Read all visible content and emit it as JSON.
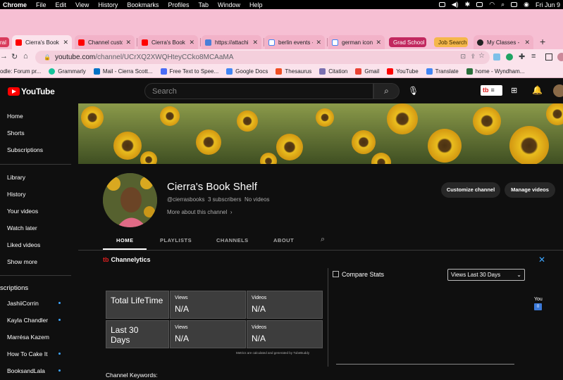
{
  "menubar": {
    "app": "Chrome",
    "items": [
      "File",
      "Edit",
      "View",
      "History",
      "Bookmarks",
      "Profiles",
      "Tab",
      "Window",
      "Help"
    ],
    "clock": "Fri Jun 9"
  },
  "tabs": [
    {
      "label": "ral",
      "type": "group_chip",
      "color": "#d93a5c"
    },
    {
      "label": "Cierra's Book S",
      "icon": "youtube-icon",
      "active": true
    },
    {
      "label": "Channel custo",
      "icon": "youtube-icon"
    },
    {
      "label": "Cierra's Book S",
      "icon": "youtube-icon"
    },
    {
      "label": "https://attachi",
      "icon": "attachment-icon"
    },
    {
      "label": "berlin events -",
      "icon": "google-icon"
    },
    {
      "label": "german iconog",
      "icon": "google-icon"
    },
    {
      "label": "Grad School",
      "type": "group_chip",
      "color": "#c2285f"
    },
    {
      "label": "Job Search",
      "type": "group_chip",
      "color": "#f5b74a"
    },
    {
      "label": "My Classes - S",
      "icon": "classes-icon"
    }
  ],
  "address": {
    "domain": "youtube.com",
    "path": "/channel/UCrXQ2XWQHteyCCko8MCAaMA"
  },
  "bookmarks": [
    {
      "label": "odle: Forum pr...",
      "color": "#f29900"
    },
    {
      "label": "Grammarly",
      "color": "#15c39a"
    },
    {
      "label": "Mail - Cierra Scott...",
      "color": "#0072c6"
    },
    {
      "label": "Free Text to Spee...",
      "color": "#4a6cf7"
    },
    {
      "label": "Google Docs",
      "color": "#4285f4"
    },
    {
      "label": "Thesaurus",
      "color": "#f04e23"
    },
    {
      "label": "Citation",
      "color": "#7a6fb0"
    },
    {
      "label": "Gmail",
      "color": "#ea4335"
    },
    {
      "label": "YouTube",
      "color": "#ff0000"
    },
    {
      "label": "Translate",
      "color": "#4285f4"
    },
    {
      "label": "home - Wyndham...",
      "color": "#2a6f3b"
    }
  ],
  "youtube": {
    "logo": "YouTube",
    "search_placeholder": "Search",
    "badge": "tb"
  },
  "sidebar": {
    "main": [
      "Home",
      "Shorts",
      "Subscriptions"
    ],
    "you": [
      "Library",
      "History",
      "Your videos",
      "Watch later",
      "Liked videos",
      "Show more"
    ],
    "subs_header": "scriptions",
    "subs": [
      {
        "name": "JashiiCorrin",
        "dot": true
      },
      {
        "name": "Kayla Chandler",
        "dot": true
      },
      {
        "name": "Marrésa Kazem",
        "dot": false
      },
      {
        "name": "How To Cake It",
        "dot": true
      },
      {
        "name": "BooksandLala",
        "dot": true
      }
    ]
  },
  "channel": {
    "name": "Cierra's Book Shelf",
    "handle": "@cierrasbooks",
    "subscribers": "3 subscribers",
    "videos": "No videos",
    "more": "More about this channel",
    "customize": "Customize channel",
    "manage": "Manage videos",
    "tabs": [
      "HOME",
      "PLAYLISTS",
      "CHANNELS",
      "ABOUT"
    ]
  },
  "channelytics": {
    "title": "Channelytics",
    "rows": [
      {
        "label": "Total LifeTime",
        "views_label": "Views",
        "views": "N/A",
        "videos_label": "Videos",
        "videos": "N/A"
      },
      {
        "label": "Last 30 Days",
        "views_label": "Views",
        "views": "N/A",
        "videos_label": "Videos",
        "videos": "N/A"
      }
    ],
    "footnote": "Metrics are calculated and generated by TubeBuddy",
    "compare_title": "Compare Stats",
    "compare_select": "Views Last 30 Days",
    "you_label": "You",
    "you_value": "0",
    "keywords_label": "Channel Keywords:"
  }
}
